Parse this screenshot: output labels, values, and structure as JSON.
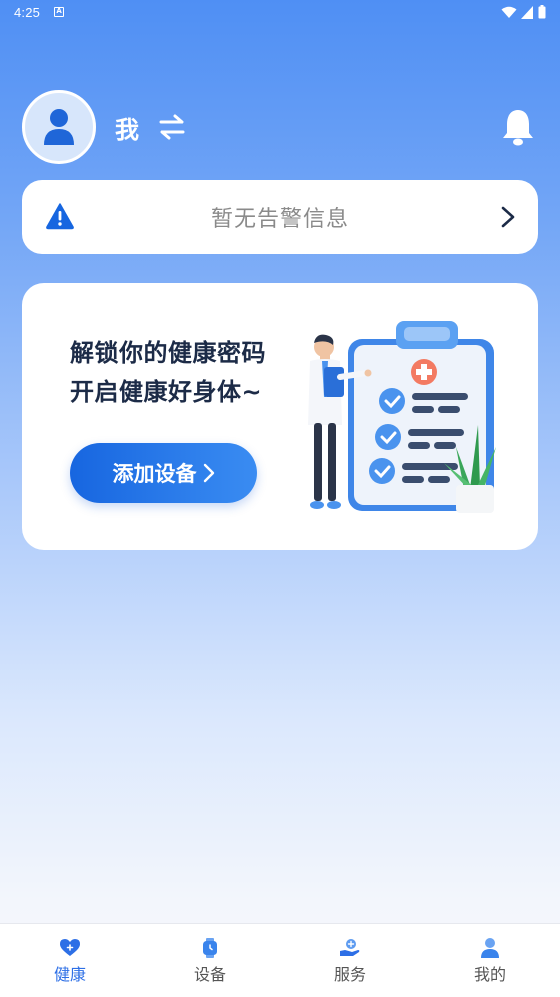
{
  "status_bar": {
    "time": "4:25",
    "notification_glyph": "A"
  },
  "header": {
    "user_name": "我"
  },
  "alert": {
    "text": "暂无告警信息"
  },
  "promo": {
    "line1": "解锁你的健康密码",
    "line2": "开启健康好身体~",
    "button_label": "添加设备"
  },
  "tabs": [
    {
      "label": "健康",
      "icon": "heart-icon",
      "active": true
    },
    {
      "label": "设备",
      "icon": "watch-icon",
      "active": false
    },
    {
      "label": "服务",
      "icon": "hand-service-icon",
      "active": false
    },
    {
      "label": "我的",
      "icon": "person-icon",
      "active": false
    }
  ],
  "colors": {
    "accent": "#2d6fe6",
    "warning_icon": "#1766e0",
    "button_start": "#1766e0",
    "button_end": "#3a8cf2"
  }
}
